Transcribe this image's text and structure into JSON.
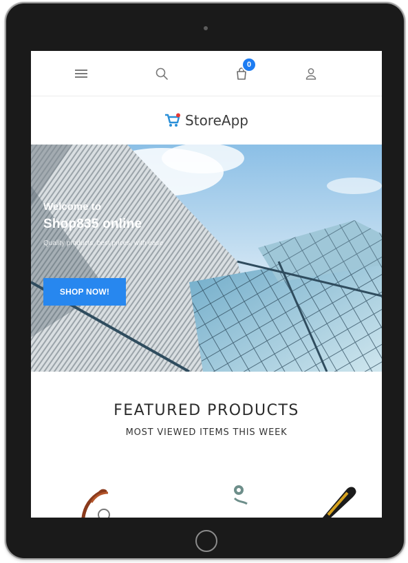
{
  "header": {
    "menu_icon": "hamburger-menu-icon",
    "search_icon": "search-icon",
    "cart_icon": "shopping-bag-icon",
    "cart_count": "0",
    "account_icon": "user-icon"
  },
  "brand": {
    "name": "StoreApp",
    "logo_icon": "shopping-cart-logo"
  },
  "hero": {
    "line1": "Welcome to",
    "line2": "Shop835 online",
    "line3": "Quality products, best prices, with ease",
    "cta_label": "SHOP NOW!"
  },
  "featured": {
    "title": "FEATURED PRODUCTS",
    "subtitle": "MOST VIEWED ITEMS THIS WEEK"
  },
  "colors": {
    "accent": "#2787ef",
    "badge": "#1d7cf2",
    "device_frame": "#1a1a1a"
  }
}
